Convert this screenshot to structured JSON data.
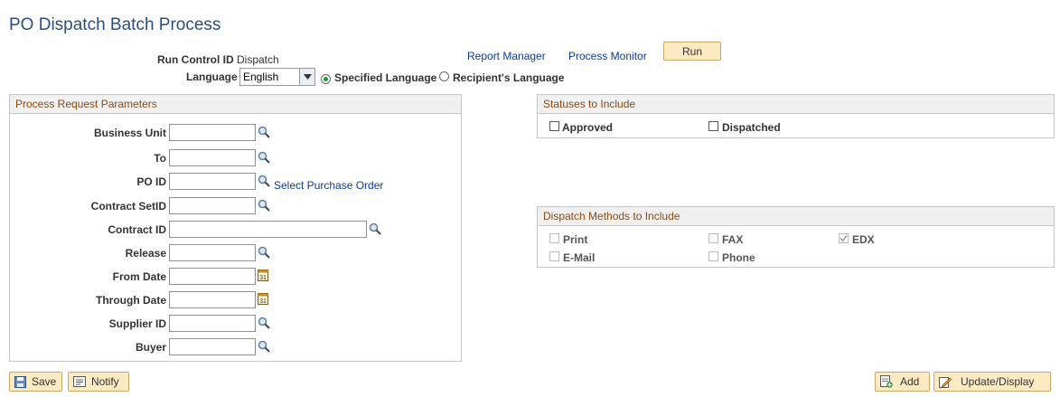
{
  "page": {
    "title": "PO Dispatch Batch Process"
  },
  "header": {
    "run_control_label": "Run Control ID",
    "run_control_value": "Dispatch",
    "language_label": "Language",
    "language_value": "English",
    "specified_language": "Specified Language",
    "recipient_language": "Recipient's Language",
    "report_manager": "Report Manager",
    "process_monitor": "Process Monitor",
    "run_button": "Run"
  },
  "params": {
    "title": "Process Request Parameters",
    "fields": [
      {
        "label": "Business Unit",
        "value": ""
      },
      {
        "label": "To",
        "value": ""
      },
      {
        "label": "PO ID",
        "value": ""
      },
      {
        "label": "Contract SetID",
        "value": ""
      },
      {
        "label": "Contract ID",
        "value": ""
      },
      {
        "label": "Release",
        "value": ""
      },
      {
        "label": "From Date",
        "value": ""
      },
      {
        "label": "Through Date",
        "value": ""
      },
      {
        "label": "Supplier ID",
        "value": ""
      },
      {
        "label": "Buyer",
        "value": ""
      }
    ],
    "select_po_link": "Select Purchase Order"
  },
  "statuses": {
    "title": "Statuses to Include",
    "approved": "Approved",
    "dispatched": "Dispatched"
  },
  "methods": {
    "title": "Dispatch Methods to Include",
    "print": "Print",
    "fax": "FAX",
    "edx": "EDX",
    "email": "E-Mail",
    "phone": "Phone"
  },
  "footer": {
    "save": "Save",
    "notify": "Notify",
    "add": "Add",
    "update_display": "Update/Display"
  },
  "colors": {
    "title": "#2a4f7a",
    "group_header": "#8a4a14",
    "link": "#0b3b9c",
    "button_bg": "#fde9c2"
  }
}
